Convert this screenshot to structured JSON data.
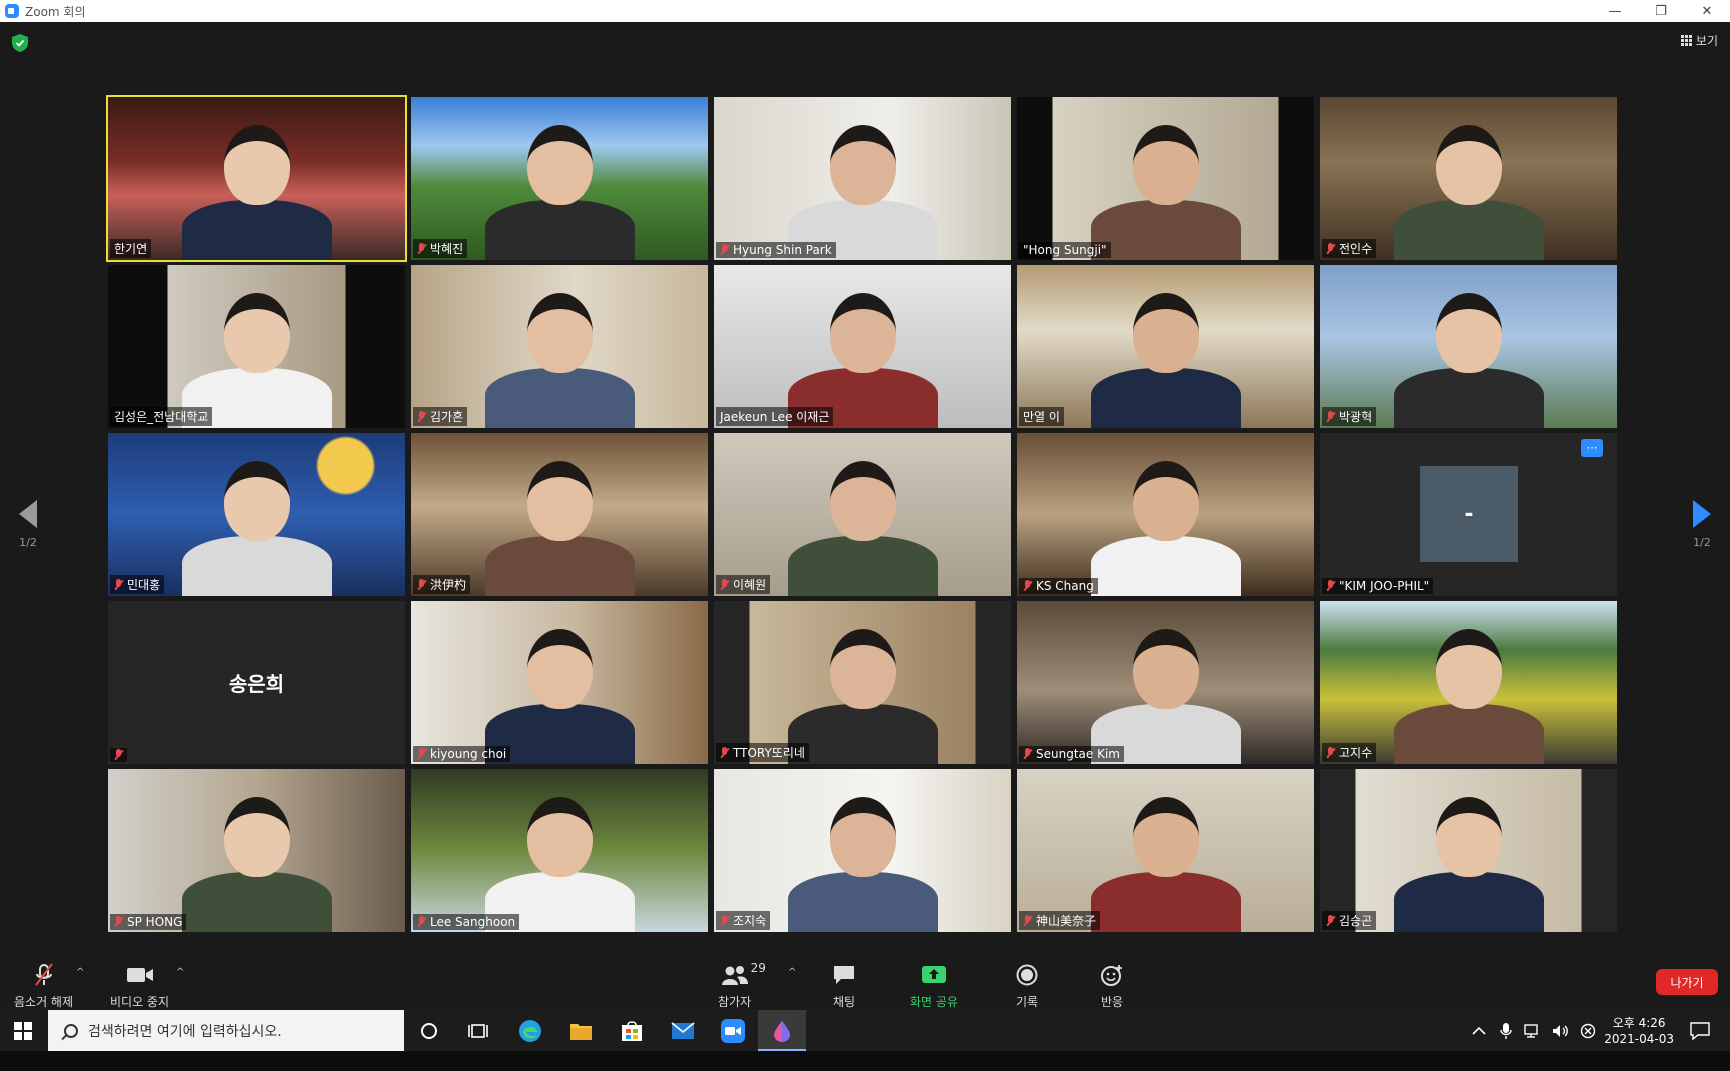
{
  "window": {
    "title": "Zoom 회의",
    "minimize": "—",
    "restore": "❐",
    "close": "✕"
  },
  "topbar": {
    "view_label": "보기"
  },
  "navigation": {
    "page_indicator": "1/2"
  },
  "participants": [
    {
      "name": "한기연",
      "muted": false,
      "active_speaker": true
    },
    {
      "name": "박혜진",
      "muted": true
    },
    {
      "name": "Hyung Shin Park",
      "muted": true
    },
    {
      "name": "\"Hong Sungji\"",
      "muted": false
    },
    {
      "name": "전인수",
      "muted": true
    },
    {
      "name": "김성은_전남대학교",
      "muted": false
    },
    {
      "name": "김가흔",
      "muted": true
    },
    {
      "name": "Jaekeun Lee 이재근",
      "muted": false
    },
    {
      "name": "만열 이",
      "muted": false
    },
    {
      "name": "박광혁",
      "muted": true
    },
    {
      "name": "민대홍",
      "muted": true
    },
    {
      "name": "洪伊杓",
      "muted": true
    },
    {
      "name": "이혜원",
      "muted": true
    },
    {
      "name": "KS Chang",
      "muted": true
    },
    {
      "name": "\"KIM JOO-PHIL\"",
      "muted": true,
      "video_off": true,
      "avatar_text": "-"
    },
    {
      "name": "송은희",
      "muted": true,
      "video_off": true,
      "name_only": true
    },
    {
      "name": "kiyoung choi",
      "muted": true
    },
    {
      "name": "TTORY또리네",
      "muted": true
    },
    {
      "name": "Seungtae Kim",
      "muted": true
    },
    {
      "name": "고지수",
      "muted": true
    },
    {
      "name": "SP HONG",
      "muted": true
    },
    {
      "name": "Lee Sanghoon",
      "muted": true
    },
    {
      "name": "조지숙",
      "muted": true
    },
    {
      "name": "神山美奈子",
      "muted": true
    },
    {
      "name": "김승곤",
      "muted": true
    }
  ],
  "more_button": "···",
  "toolbar": {
    "unmute_label": "음소거 해제",
    "video_label": "비디오 중지",
    "participants_label": "참가자",
    "participants_count": "29",
    "chat_label": "채팅",
    "share_label": "화면 공유",
    "record_label": "기록",
    "reactions_label": "반응",
    "leave_label": "나가기",
    "caret": "^"
  },
  "taskbar": {
    "search_placeholder": "검색하려면 여기에 입력하십시오.",
    "time": "오후 4:26",
    "date": "2021-04-03"
  },
  "colors": {
    "accent": "#2d8cff",
    "active_speaker": "#e6e13a",
    "share_green": "#3bd16f",
    "leave_red": "#e02828",
    "muted_red": "#e5484d"
  }
}
